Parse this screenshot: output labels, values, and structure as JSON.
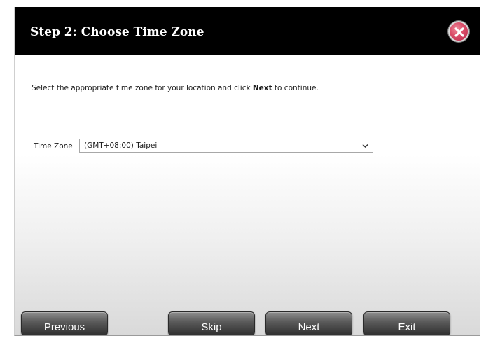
{
  "dialog": {
    "title": "Step 2: Choose Time Zone",
    "close_icon": "close-icon"
  },
  "instruction": {
    "before": "Select the appropriate time zone for your location and click ",
    "emphasis": "Next",
    "after": " to continue."
  },
  "time_zone": {
    "label": "Time Zone",
    "selected": "(GMT+08:00) Taipei"
  },
  "buttons": {
    "previous": "Previous",
    "skip": "Skip",
    "next": "Next",
    "exit": "Exit"
  },
  "colors": {
    "title_bar": "#000000",
    "close_icon": "#d94c68",
    "button": "#4a4a4a"
  }
}
